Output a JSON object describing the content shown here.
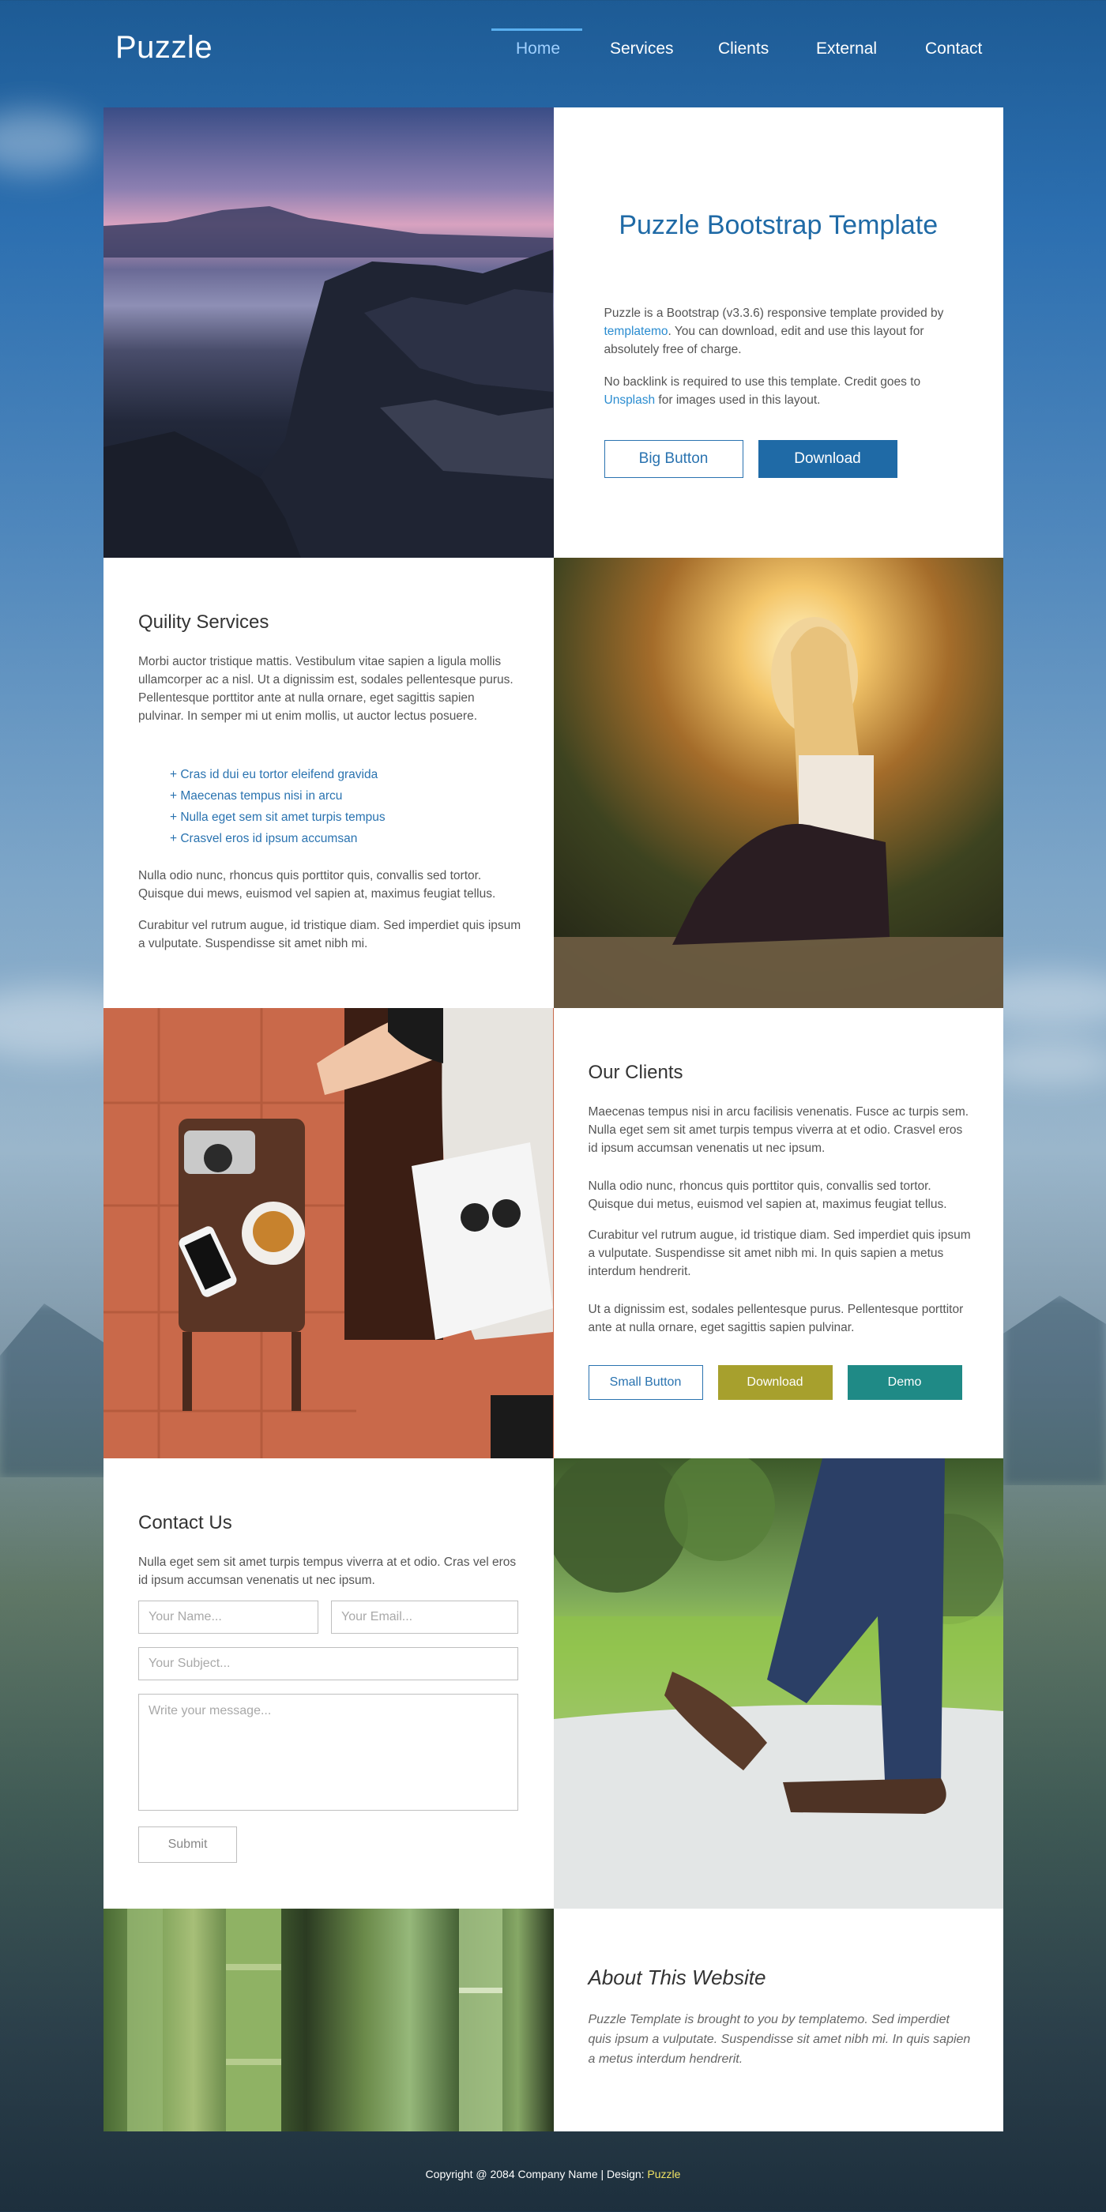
{
  "brand": "Puzzle",
  "nav": {
    "items": [
      "Home",
      "Services",
      "Clients",
      "External",
      "Contact"
    ],
    "active": "Home"
  },
  "hero": {
    "title": "Puzzle Bootstrap Template",
    "p1_pre": "Puzzle is a Bootstrap (v3.3.6) responsive template provided by ",
    "p1_link": "templatemo",
    "p1_post": ". You can download, edit and use this layout for absolutely free of charge.",
    "p2_pre": "No backlink is required to use this template. Credit goes to ",
    "p2_link": "Unsplash",
    "p2_post": " for images used in this layout.",
    "button_big": "Big Button",
    "button_download": "Download"
  },
  "services": {
    "title": "Quility Services",
    "p1": "Morbi auctor tristique mattis. Vestibulum vitae sapien a ligula mollis ullamcorper ac a nisl. Ut a dignissim est, sodales pellentesque purus. Pellentesque porttitor ante at nulla ornare, eget sagittis sapien pulvinar. In semper mi ut enim mollis, ut auctor lectus posuere.",
    "list": [
      "+ Cras id dui eu tortor eleifend gravida",
      "+ Maecenas tempus nisi in arcu",
      "+ Nulla eget sem sit amet turpis tempus",
      "+ Crasvel eros id ipsum accumsan"
    ],
    "p2": "Nulla odio nunc, rhoncus quis porttitor quis, convallis sed tortor. Quisque dui mews, euismod vel sapien at, maximus feugiat tellus.",
    "p3": "Curabitur vel rutrum augue, id tristique diam. Sed imperdiet quis ipsum a vulputate. Suspendisse sit amet nibh mi."
  },
  "clients": {
    "title": "Our Clients",
    "p1": "Maecenas tempus nisi in arcu facilisis venenatis. Fusce ac turpis sem. Nulla eget sem sit amet turpis tempus viverra at et odio. Crasvel eros id ipsum accumsan venenatis ut nec ipsum.",
    "p2": "Nulla odio nunc, rhoncus quis porttitor quis, convallis sed tortor. Quisque dui metus, euismod vel sapien at, maximus feugiat tellus.",
    "p3": "Curabitur vel rutrum augue, id tristique diam. Sed imperdiet quis ipsum a vulputate. Suspendisse sit amet nibh mi. In quis sapien a metus interdum hendrerit.",
    "p4": "Ut a dignissim est, sodales pellentesque purus. Pellentesque porttitor ante at nulla ornare, eget sagittis sapien pulvinar.",
    "button_small": "Small Button",
    "button_download": "Download",
    "button_demo": "Demo"
  },
  "contact": {
    "title": "Contact Us",
    "p": "Nulla eget sem sit amet turpis tempus viverra at et odio. Cras vel eros id ipsum accumsan venenatis ut nec ipsum.",
    "name_placeholder": "Your Name...",
    "email_placeholder": "Your Email...",
    "subject_placeholder": "Your Subject...",
    "message_placeholder": "Write your message...",
    "submit": "Submit"
  },
  "about": {
    "title": "About This Website",
    "p": "Puzzle Template is brought to you by templatemo. Sed imperdiet quis ipsum a vulputate. Suspendisse sit amet nibh mi. In quis sapien a metus interdum hendrerit."
  },
  "footer": {
    "text": "Copyright @ 2084 Company Name | Design: ",
    "link": "Puzzle"
  },
  "colors": {
    "primary": "#1f6aa6",
    "link": "#2a8cd0",
    "olive": "#a7a02d",
    "teal": "#1f8a86",
    "footer_link": "#f0e264"
  }
}
